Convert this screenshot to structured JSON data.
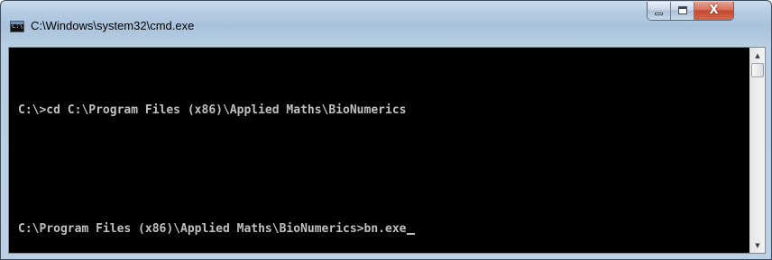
{
  "window": {
    "title": "C:\\Windows\\system32\\cmd.exe",
    "app_icon_text": "C:\\."
  },
  "caption_buttons": {
    "minimize": "minimize-icon",
    "maximize": "maximize-icon",
    "close_glyph": "X"
  },
  "console": {
    "lines": [
      "C:\\>cd C:\\Program Files (x86)\\Applied Maths\\BioNumerics",
      "",
      "C:\\Program Files (x86)\\Applied Maths\\BioNumerics>bn.exe"
    ],
    "text_color": "#c0c0c0",
    "background_color": "#000000"
  },
  "scrollbar": {
    "up_arrow": "▲",
    "down_arrow": "▼"
  }
}
